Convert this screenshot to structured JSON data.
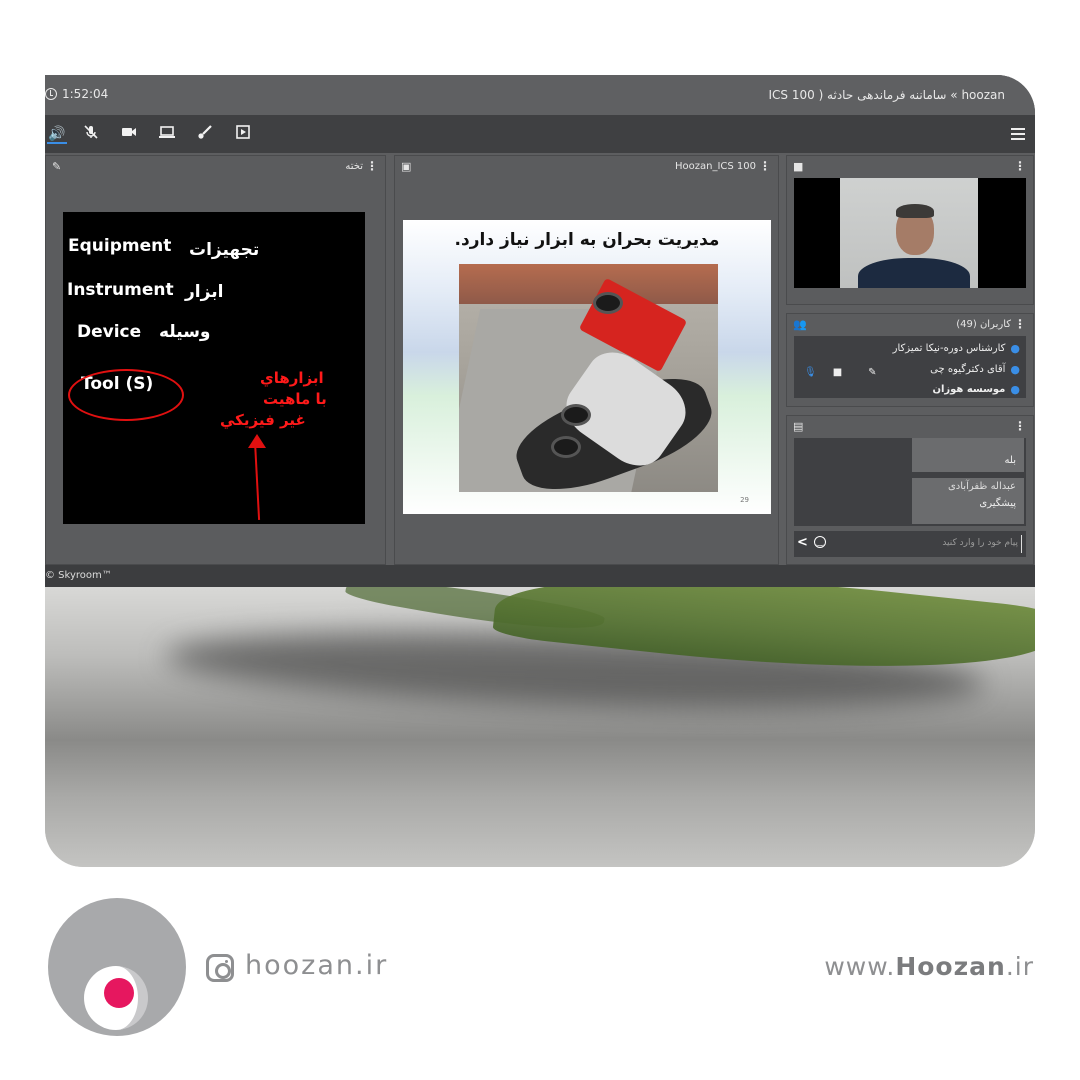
{
  "titlebar": {
    "timer": "1:52:04",
    "room_title": "hoozan » ساماننه فرماندهی حادثه ( ICS 100"
  },
  "toolbar": {
    "icons": [
      "speaker-icon",
      "mic-muted-icon",
      "camera-icon",
      "screen-share-icon",
      "brush-icon",
      "play-icon",
      "menu-icon"
    ]
  },
  "whiteboard": {
    "title": "تخته",
    "lines": [
      {
        "en": "Equipment",
        "fa": "تجهیزات"
      },
      {
        "en": "Instrument",
        "fa": "ابزار"
      },
      {
        "en": "Device",
        "fa": "وسیله"
      },
      {
        "en": "Tool (S)"
      }
    ],
    "note_lines": [
      "ابزارهاي",
      "با ماهيت",
      "غير فيزيکي"
    ]
  },
  "presentation": {
    "title": "Hoozan_ICS 100",
    "slide_heading": "مدیریت بحران به ابزار نیاز دارد.",
    "slide_number": "29"
  },
  "users": {
    "title": "کاربران (49)",
    "list": [
      {
        "name": "کارشناس دوره-نیکا تمیزکار",
        "bold": false
      },
      {
        "name": "آقای دکترگیوه چی",
        "bold": false
      },
      {
        "name": "موسسه هوزان",
        "bold": true
      }
    ]
  },
  "chat": {
    "messages": [
      {
        "author": "",
        "text": "بله"
      },
      {
        "author": "عبداله ظفرآبادی",
        "text": "پیشگیری"
      }
    ],
    "input_placeholder": "پیام خود را وارد کنید"
  },
  "footer": {
    "copyright": "© Skyroom™"
  },
  "brand": {
    "instagram": "hoozan.ir",
    "website_prefix": "www.",
    "website_name": "Hoozan",
    "website_suffix": ".ir",
    "colors": {
      "accent": "#e6175f",
      "gray": "#8e8f91"
    }
  }
}
